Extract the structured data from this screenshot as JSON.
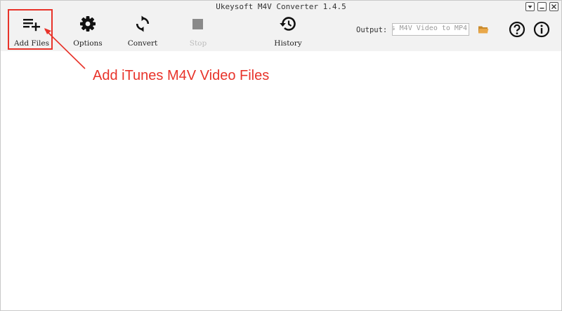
{
  "window": {
    "title": "Ukeysoft M4V Converter 1.4.5"
  },
  "toolbar": {
    "add_files": "Add Files",
    "options": "Options",
    "convert": "Convert",
    "stop": "Stop",
    "history": "History",
    "output_label": "Output:",
    "output_value": "s M4V Video to MP4"
  },
  "annotation": {
    "text": "Add iTunes M4V Video Files"
  },
  "colors": {
    "accent": "#e8332a",
    "toolbar_bg": "#f2f2f2",
    "disabled": "#bdbdbd"
  }
}
